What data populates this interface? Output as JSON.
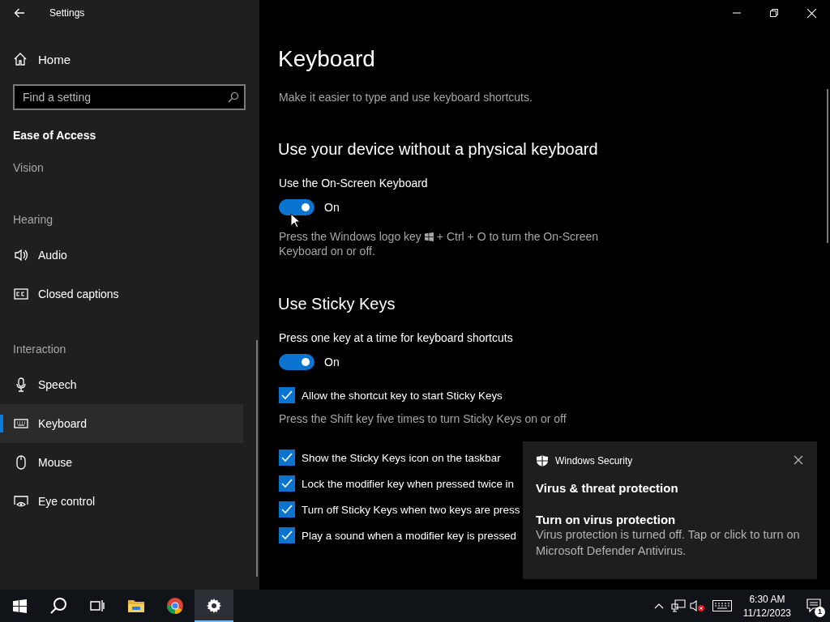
{
  "window": {
    "title": "Settings"
  },
  "sidebar": {
    "home": "Home",
    "search": {
      "placeholder": "Find a setting"
    },
    "category": "Ease of Access",
    "items": [
      {
        "kind": "header",
        "label": "Vision"
      },
      {
        "kind": "header",
        "label": "Hearing"
      },
      {
        "kind": "item",
        "label": "Audio",
        "selected": false
      },
      {
        "kind": "item",
        "label": "Closed captions",
        "selected": false
      },
      {
        "kind": "header",
        "label": "Interaction"
      },
      {
        "kind": "item",
        "label": "Speech",
        "selected": false
      },
      {
        "kind": "item",
        "label": "Keyboard",
        "selected": true
      },
      {
        "kind": "item",
        "label": "Mouse",
        "selected": false
      },
      {
        "kind": "item",
        "label": "Eye control",
        "selected": false
      }
    ]
  },
  "main": {
    "title": "Keyboard",
    "description": "Make it easier to type and use keyboard shortcuts.",
    "sections": [
      {
        "heading": "Use your device without a physical keyboard",
        "settings": [
          {
            "kind": "toggle",
            "label": "Use the On-Screen Keyboard",
            "on": true,
            "state_text": "On"
          },
          {
            "kind": "key_hint",
            "text_before": "Press the Windows logo key",
            "text_after": "+ Ctrl + O to turn the On-Screen",
            "text_line2": "Keyboard on or off."
          }
        ]
      },
      {
        "heading": "Use Sticky Keys",
        "settings": [
          {
            "kind": "toggle",
            "label": "Press one key at a time for keyboard shortcuts",
            "on": true,
            "state_text": "On"
          },
          {
            "kind": "checkbox",
            "label": "Allow the shortcut key to start Sticky Keys",
            "checked": true
          },
          {
            "kind": "hint",
            "text": "Press the Shift key five times to turn Sticky Keys on or off"
          },
          {
            "kind": "checkbox",
            "label": "Show the Sticky Keys icon on the taskbar",
            "checked": true
          },
          {
            "kind": "checkbox",
            "label": "Lock the modifier key when pressed twice in",
            "checked": true
          },
          {
            "kind": "checkbox",
            "label": "Turn off Sticky Keys when two keys are press",
            "checked": true
          },
          {
            "kind": "checkbox",
            "label": "Play a sound when a modifier key is pressed",
            "checked": true
          }
        ]
      }
    ]
  },
  "toast": {
    "app": "Windows Security",
    "title": "Virus & threat protection",
    "heading": "Turn on virus protection",
    "body": "Virus protection is turned off. Tap or click to turn on Microsoft Defender Antivirus."
  },
  "taskbar": {
    "apps": [
      {
        "kind": "explorer",
        "selected": false
      },
      {
        "kind": "browser",
        "selected": false
      },
      {
        "kind": "settings",
        "selected": true
      }
    ],
    "time": "6:30 AM",
    "date": "11/12/2023",
    "notification_count": "1"
  }
}
